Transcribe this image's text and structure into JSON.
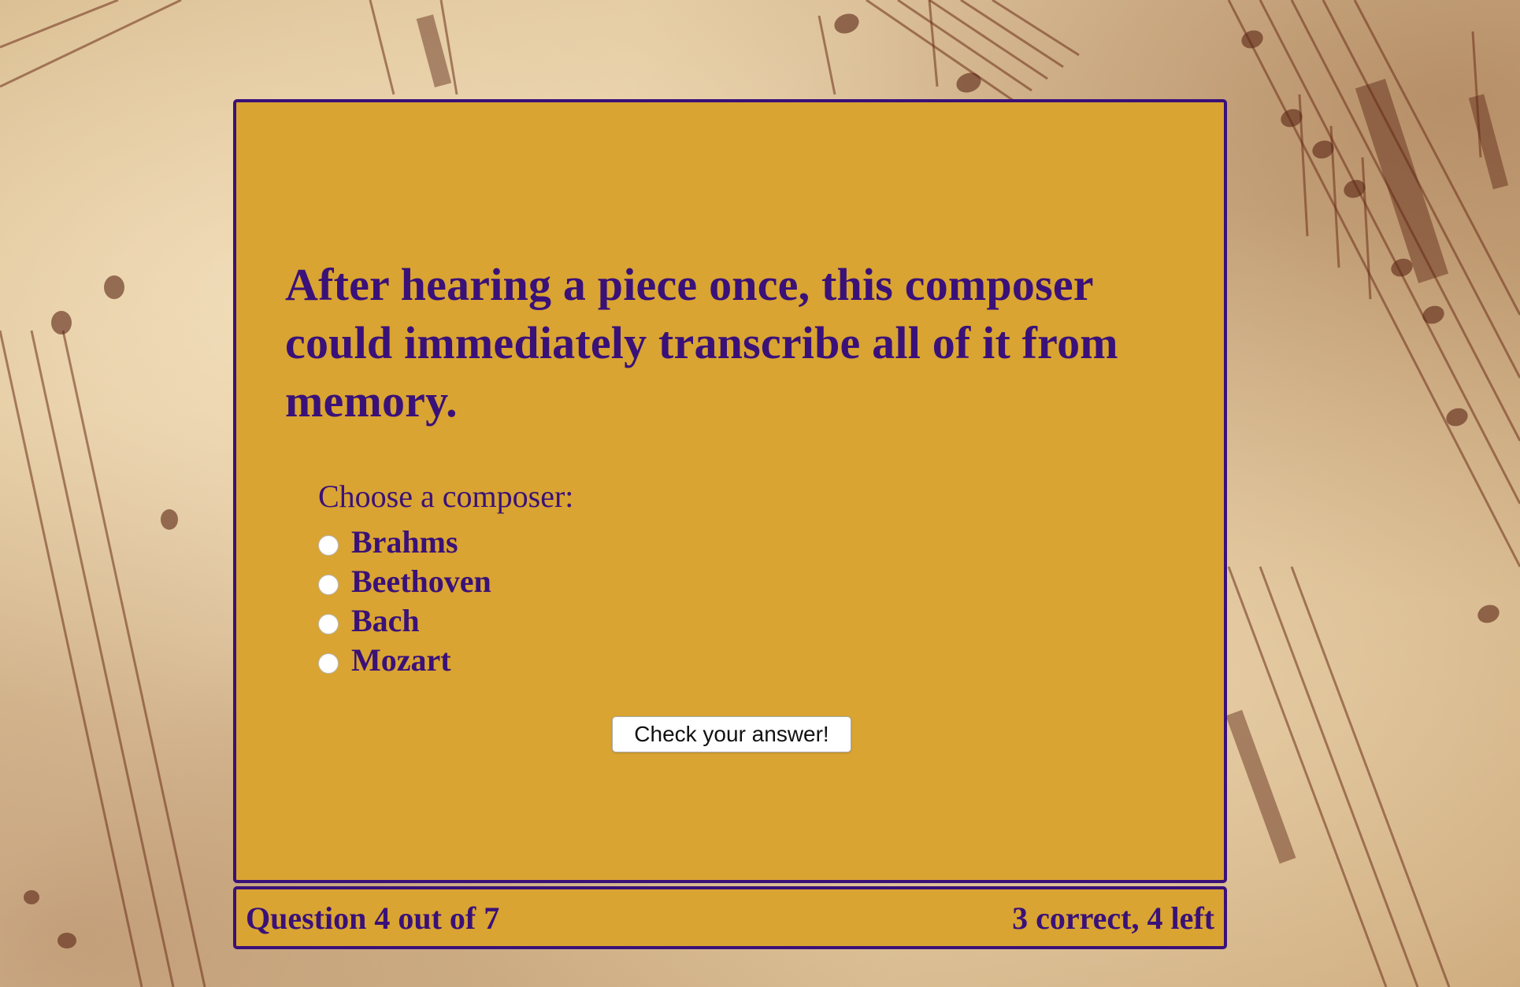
{
  "theme": {
    "card_background": "#d9a431",
    "accent": "#3a1178",
    "page_background": "#dcc096"
  },
  "background": {
    "icon": "sheet-music-background"
  },
  "quiz": {
    "question": "After hearing a piece once, this composer could immediately transcribe all of it from memory.",
    "prompt": "Choose a composer:",
    "options": [
      {
        "label": "Brahms",
        "selected": false
      },
      {
        "label": "Beethoven",
        "selected": false
      },
      {
        "label": "Bach",
        "selected": false
      },
      {
        "label": "Mozart",
        "selected": false
      }
    ],
    "submit_label": "Check your answer!"
  },
  "status": {
    "progress": "Question 4 out of 7",
    "score": "3 correct, 4 left"
  }
}
